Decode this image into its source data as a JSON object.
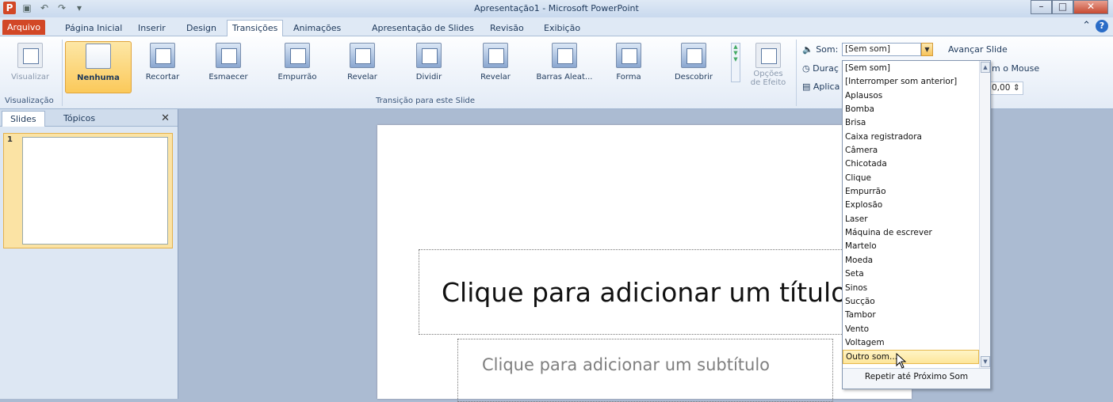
{
  "window": {
    "title": "Apresentação1 - Microsoft PowerPoint"
  },
  "tabs": [
    {
      "label": "Arquivo"
    },
    {
      "label": "Página Inicial"
    },
    {
      "label": "Inserir"
    },
    {
      "label": "Design"
    },
    {
      "label": "Transições"
    },
    {
      "label": "Animações"
    },
    {
      "label": "Apresentação de Slides"
    },
    {
      "label": "Revisão"
    },
    {
      "label": "Exibição"
    }
  ],
  "ribbon": {
    "preview_label": "Visualizar",
    "preview_group": "Visualização",
    "transitions": [
      {
        "label": "Nenhuma"
      },
      {
        "label": "Recortar"
      },
      {
        "label": "Esmaecer"
      },
      {
        "label": "Empurrão"
      },
      {
        "label": "Revelar"
      },
      {
        "label": "Dividir"
      },
      {
        "label": "Revelar"
      },
      {
        "label": "Barras Aleat..."
      },
      {
        "label": "Forma"
      },
      {
        "label": "Descobrir"
      }
    ],
    "effect_options_line1": "Opções",
    "effect_options_line2": "de Efeito",
    "transition_group": "Transição para este Slide",
    "sound_label": "Som:",
    "sound_value": "[Sem som]",
    "advance_label": "Avançar Slide",
    "duration_label": "Duraç",
    "apply_label": "Aplica",
    "on_mouse_label": "m o Mouse",
    "after_value": "0,00"
  },
  "slides_panel": {
    "tab_slides": "Slides",
    "tab_outline": "Tópicos",
    "slide_number": "1"
  },
  "slide": {
    "title_placeholder": "Clique para adicionar um título",
    "subtitle_placeholder": "Clique para adicionar um subtítulo"
  },
  "sound_dropdown": {
    "items": [
      "[Sem som]",
      "[Interromper som anterior]",
      "Aplausos",
      "Bomba",
      "Brisa",
      "Caixa registradora",
      "Câmera",
      "Chicotada",
      "Clique",
      "Empurrão",
      "Explosão",
      "Laser",
      "Máquina de escrever",
      "Martelo",
      "Moeda",
      "Seta",
      "Sinos",
      "Sucção",
      "Tambor",
      "Vento",
      "Voltagem",
      "Outro som..."
    ],
    "highlighted": "Outro som...",
    "loop_label": "Repetir até Próximo Som"
  }
}
